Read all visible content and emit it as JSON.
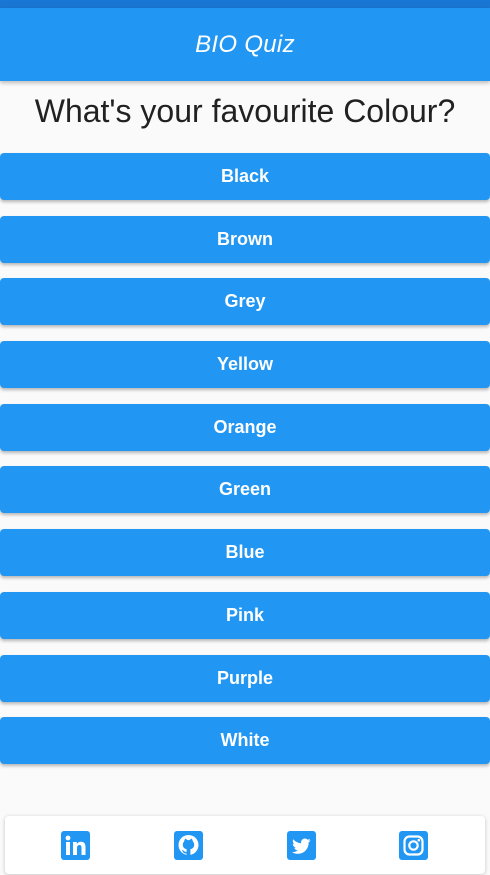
{
  "app": {
    "title": "BIO Quiz"
  },
  "quiz": {
    "question": "What's your favourite Colour?",
    "answers": [
      "Black",
      "Brown",
      "Grey",
      "Yellow",
      "Orange",
      "Green",
      "Blue",
      "Pink",
      "Purple",
      "White"
    ]
  },
  "social": [
    {
      "name": "linkedin-icon"
    },
    {
      "name": "github-icon"
    },
    {
      "name": "twitter-icon"
    },
    {
      "name": "instagram-icon"
    }
  ],
  "colors": {
    "primary": "#2196f3",
    "statusbar": "#1976d2",
    "background": "#fafafa"
  }
}
